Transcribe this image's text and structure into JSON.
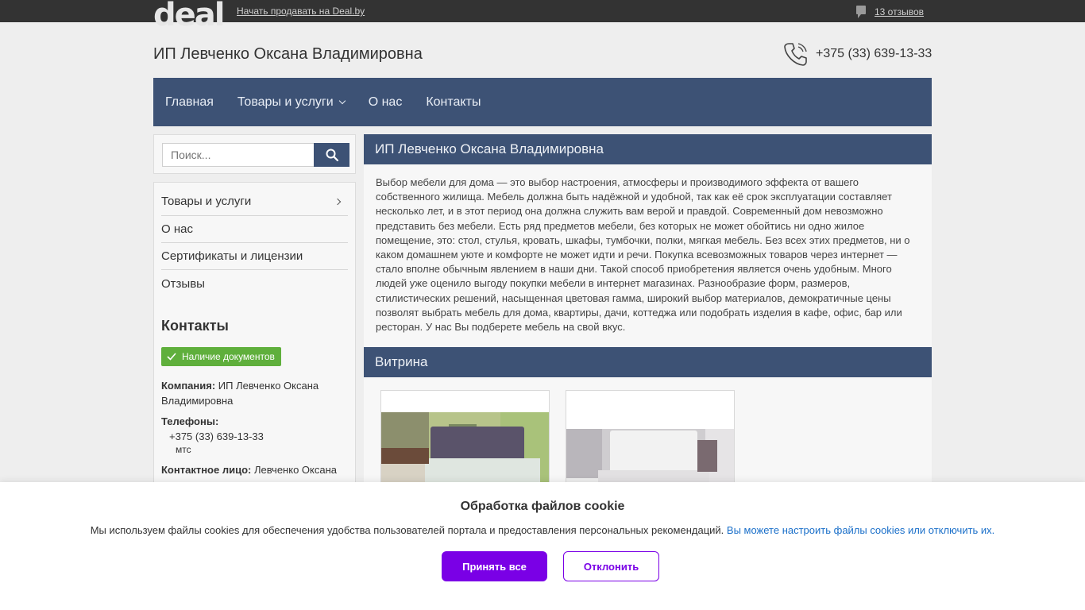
{
  "topbar": {
    "logo": "deal",
    "sell_link": "Начать продавать на Deal.by",
    "reviews_link": "13 отзывов"
  },
  "header": {
    "company_title": "ИП Левченко Оксана Владимировна",
    "phone": "+375 (33) 639-13-33"
  },
  "nav": {
    "items": [
      {
        "label": "Главная"
      },
      {
        "label": "Товары и услуги"
      },
      {
        "label": "О нас"
      },
      {
        "label": "Контакты"
      }
    ]
  },
  "search": {
    "placeholder": "Поиск..."
  },
  "sidebar": {
    "items": [
      {
        "label": "Товары и услуги"
      },
      {
        "label": "О нас"
      },
      {
        "label": "Сертификаты и лицензии"
      },
      {
        "label": "Отзывы"
      }
    ],
    "contacts_title": "Контакты",
    "doc_badge": "Наличие документов",
    "company_label": "Компания:",
    "company_value": "ИП Левченко Оксана Владимировна",
    "phones_label": "Телефоны:",
    "phone_value": "+375 (33) 639-13-33",
    "phone_operator": "мтс",
    "contact_person_label": "Контактное лицо:",
    "contact_person_value": "Левченко Оксана"
  },
  "main": {
    "header": "ИП Левченко Оксана Владимировна",
    "text": "Выбор мебели для дома — это выбор настроения, атмосферы и производимого эффекта от вашего собственного жилища. Мебель должна быть надёжной и удобной, так как её срок эксплуатации составляет несколько лет, и в этот период она должна служить вам верой и правдой. Современный дом невозможно представить без мебели. Есть ряд предметов мебели, без которых не может обойтись ни одно жилое помещение, это: стол, стулья, кровать, шкафы, тумбочки, полки, мягкая мебель. Без всех этих предметов, ни о каком домашнем уюте и комфорте не может идти и речи. Покупка всевозможных товаров через интернет — стало вполне обычным явлением в наши дни. Такой способ приобретения является очень удобным. Много людей уже оценило выгоду покупки мебели в интернет магазинах. Разнообразие форм, размеров, стилистических решений, насыщенная цветовая гамма, широкий выбор материалов, демократичные цены позволят выбрать мебель для дома, квартиры, дачи, коттеджа или подобрать изделия в кафе, офис, бар или ресторан. У нас Вы подберете мебель на свой вкус.",
    "vitrina_header": "Витрина"
  },
  "cookie": {
    "title": "Обработка файлов cookie",
    "text": "Мы используем файлы cookies для обеспечения удобства пользователей портала и предоставления персональных рекомендаций.",
    "link": "Вы можете настроить файлы cookies или отключить их.",
    "accept": "Принять все",
    "decline": "Отклонить"
  },
  "colors": {
    "nav_bg": "#3d5275",
    "topbar_bg": "#333333",
    "accept_bg": "#7a00e6",
    "badge_green": "#5faf3c",
    "link_blue": "#1a6fc9"
  }
}
